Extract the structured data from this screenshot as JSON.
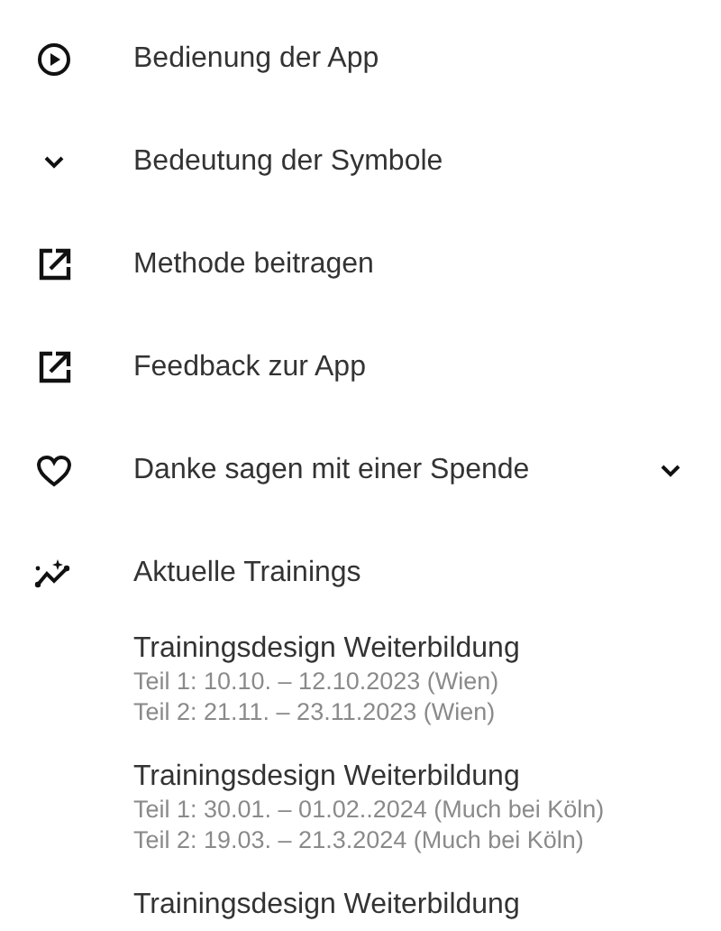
{
  "menu": [
    {
      "kind": "play",
      "label": "Bedienung der App",
      "expandable": false
    },
    {
      "kind": "chevron",
      "label": "Bedeutung der Symbole",
      "expandable": false
    },
    {
      "kind": "external",
      "label": "Methode beitragen",
      "expandable": false
    },
    {
      "kind": "external",
      "label": "Feedback zur App",
      "expandable": false
    },
    {
      "kind": "heart",
      "label": "Danke sagen mit einer Spende",
      "expandable": true
    },
    {
      "kind": "sparkline",
      "label": "Aktuelle Trainings",
      "expandable": false
    }
  ],
  "trainings": [
    {
      "title": "Trainingsdesign Weiterbildung",
      "lines": [
        "Teil 1: 10.10. – 12.10.2023 (Wien)",
        "Teil 2: 21.11. – 23.11.2023 (Wien)"
      ]
    },
    {
      "title": "Trainingsdesign Weiterbildung",
      "lines": [
        "Teil 1: 30.01. – 01.02..2024 (Much bei  Köln)",
        "Teil 2: 19.03. – 21.3.2024 (Much bei Köln)"
      ]
    },
    {
      "title": "Trainingsdesign Weiterbildung"
    }
  ]
}
